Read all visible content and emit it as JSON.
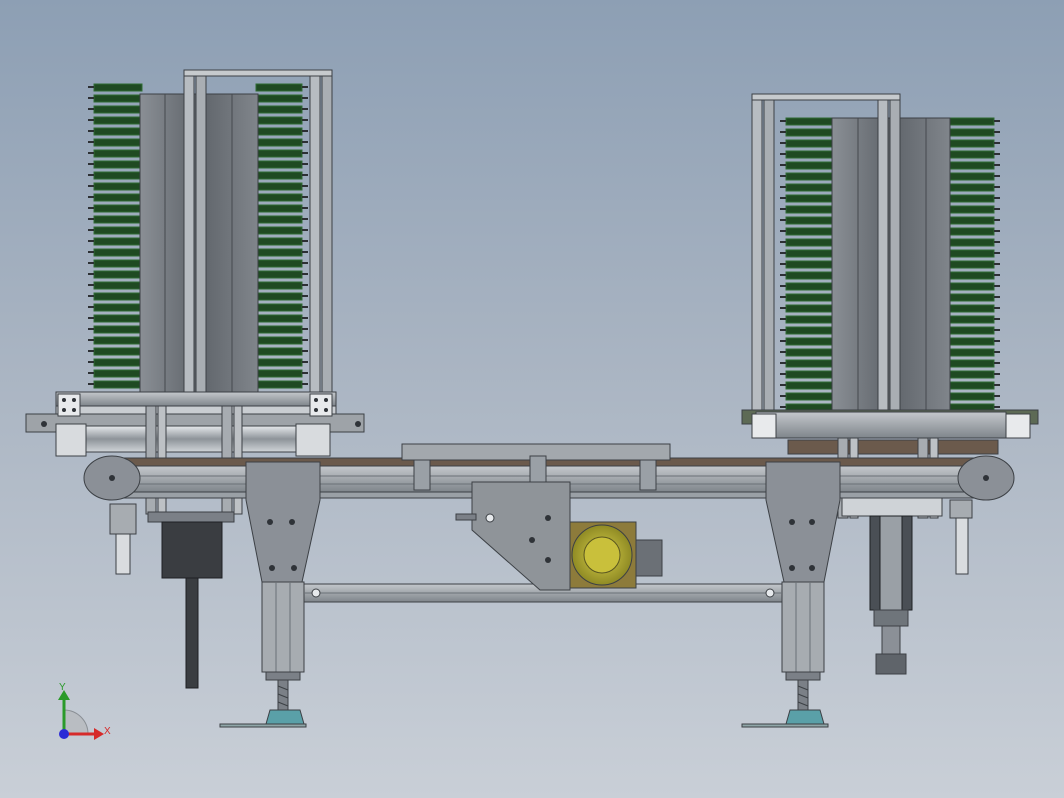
{
  "triad": {
    "x_label": "X",
    "y_label": "Y"
  },
  "colors": {
    "frame": "#9aa0a6",
    "frame_dark": "#5b6168",
    "board": "#1f4a22",
    "board_edge": "#2f6b33",
    "column": "#6d7278",
    "belt": "#6b5a4c",
    "gear": "#b6b035",
    "axis_x": "#d62a2a",
    "axis_y": "#2a9a2a",
    "axis_z": "#2a2ad6"
  }
}
